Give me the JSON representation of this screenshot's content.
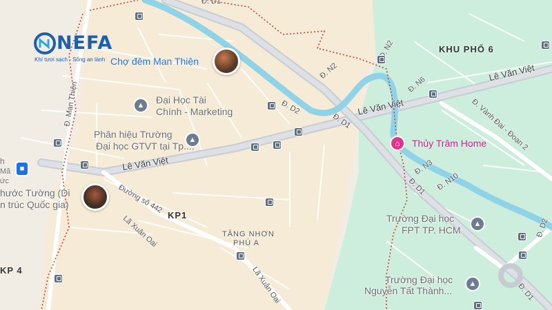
{
  "map": {
    "streets": {
      "d1_top": "Đ. D1",
      "le_van_viet_west": "Lê Văn Việt",
      "le_van_viet_mid": "Lê Văn Việt",
      "le_van_viet_east": "Lê Văn Việt",
      "d2": "Đ. D2",
      "d1_mid": "Đ. D1",
      "d1_south": "Đ. D1",
      "d1_se": "Đ. D1",
      "n2": "Đ. N2",
      "n2b": "Đ. N2",
      "n6": "Đ. N6",
      "n3": "Đ. N3",
      "n10": "Đ. N10",
      "vanh_dai": "Đ. Vành Đai - Đoạn 2",
      "man_thien": "Đ. Man Thiện",
      "duong_442": "Đường số 442",
      "la_xuan_oai_1": "Lã Xuân Oai",
      "la_xuan_oai_2": "Lã Xuân Oai",
      "d2_edge": "Đ. D2",
      "d2_se": "Đ. D2"
    },
    "areas": {
      "khu_pho_6": "KHU PHỐ 6",
      "kp1": "KP1",
      "kp4": "KP 4",
      "tang_nhon_phu_a_1": "TĂNG NHƠN",
      "tang_nhon_phu_a_2": "PHÚ A"
    },
    "pois": {
      "cho_dem": "Chợ đêm Man Thiện",
      "dh_tai_chinh_1": "Đại Học Tài",
      "dh_tai_chinh_2": "Chính - Marketing",
      "phan_hieu_1": "Phân hiệu Trường",
      "phan_hieu_2": "Đại học GTVT tại Tp....",
      "thuy_tram": "Thủy Trâm Home",
      "fpt_1": "Trường Đại học",
      "fpt_2": "FPT TP. HCM",
      "ntt_1": "Trường Đại học",
      "ntt_2": "Nguyễn Tất Thành...",
      "phuoc_tuong_1": "hước Tường (Di",
      "phuoc_tuong_2": "n trúc Quốc gia)",
      "edge_h": "h",
      "edge_ma": "Mã",
      "edge_uc": "ức"
    },
    "icons": {
      "bus": "bus-stop-icon",
      "school": "school-icon",
      "shop": "shopping-bag-icon",
      "pink": "home-pin-icon"
    }
  },
  "logo": {
    "name": "NEFA",
    "tagline": "Khí tươi sạch - Sống an lành"
  },
  "colors": {
    "land": "#f2ede4",
    "green_zone": "#cdeedd",
    "river": "#8fd3e8",
    "main_road": "#c7ccd3",
    "boundary": "#d23b2a",
    "brand": "#1d5fae",
    "poi_blue": "#1a73e8",
    "poi_pink": "#d01884"
  }
}
